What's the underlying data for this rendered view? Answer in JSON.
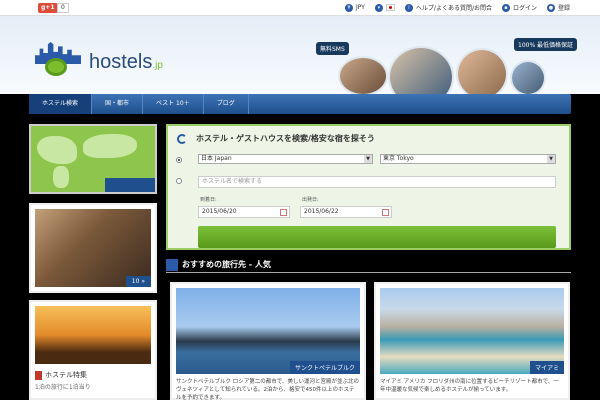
{
  "topbar": {
    "gplus_label": "g+1",
    "gplus_count": "0",
    "currency": "JPY",
    "language_label": "",
    "help_label": "ヘルプ/よくある質問/お問合",
    "login_label": "ログイン",
    "signup_label": "登録"
  },
  "logo": {
    "name": "hostels",
    "tld": ".jp"
  },
  "header": {
    "sms_tag": "無料SMS",
    "guarantee_tag": "100% 最低価格保証"
  },
  "nav": {
    "items": [
      "ホステル検索",
      "国・都市",
      "ベスト 10＋",
      "ブログ"
    ]
  },
  "side": {
    "photo_count": "10 »",
    "sunset_title": "ホステル特集",
    "sunset_sub": "1泊の旅行に1泊当り"
  },
  "search": {
    "title": "ホステル・ゲストハウスを検索/格安な宿を探そう",
    "country": "日本 Japan",
    "city": "東京 Tokyo",
    "keyword_placeholder": "ホステル名で検索する",
    "checkin_label": "到着日:",
    "checkout_label": "出発日:",
    "checkin": "2015/06/20",
    "checkout": "2015/06/22"
  },
  "section": {
    "title": "おすすめの旅行先 - 人気"
  },
  "cards": [
    {
      "caption": "サンクトペテルブルク",
      "text": "サンクトペテルブルク ロシア第二の都市で、美しい運河と宮殿が並ぶ北のヴェネツィアとして知られている。2泊から、格安で450件以上のホステルを予約できます。"
    },
    {
      "caption": "マイアミ",
      "text": "マイアミ アメリカ フロリダ州の南に位置するビーチリゾート都市で、一年中温暖な気候で楽しめるホステルが揃っています。"
    }
  ],
  "colors": {
    "accent": "#2a5aa8",
    "green": "#7cc13a",
    "nav": "#1f4f8c"
  }
}
